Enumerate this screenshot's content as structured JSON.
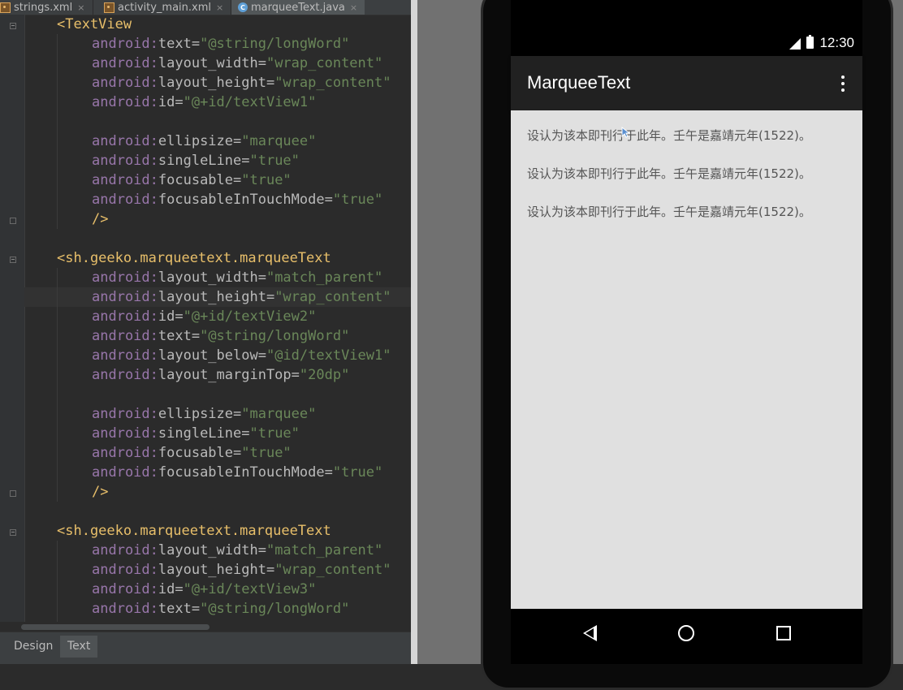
{
  "ide": {
    "tabs": [
      {
        "label": "strings.xml",
        "icon": "xml-file-icon"
      },
      {
        "label": "activity_main.xml",
        "icon": "xml-file-icon"
      },
      {
        "label": "marqueeText.java",
        "icon": "java-class-icon"
      }
    ],
    "tab_close": "×",
    "code_lines": [
      {
        "t": "<",
        "tag": "TextView"
      },
      {
        "a": "text",
        "v": "\"@string/longWord\""
      },
      {
        "a": "layout_width",
        "v": "\"wrap_content\""
      },
      {
        "a": "layout_height",
        "v": "\"wrap_content\""
      },
      {
        "a": "id",
        "v": "\"@+id/textView1\""
      },
      {},
      {
        "a": "ellipsize",
        "v": "\"marquee\""
      },
      {
        "a": "singleLine",
        "v": "\"true\""
      },
      {
        "a": "focusable",
        "v": "\"true\""
      },
      {
        "a": "focusableInTouchMode",
        "v": "\"true\""
      },
      {
        "close": "/>"
      },
      {},
      {
        "t": "<",
        "tag": "sh.geeko.marqueetext.marqueeText"
      },
      {
        "a": "layout_width",
        "v": "\"match_parent\""
      },
      {
        "a": "layout_height",
        "v": "\"wrap_content\""
      },
      {
        "a": "id",
        "v": "\"@+id/textView2\""
      },
      {
        "a": "text",
        "v": "\"@string/longWord\""
      },
      {
        "a": "layout_below",
        "v": "\"@id/textView1\""
      },
      {
        "a": "layout_marginTop",
        "v": "\"20dp\""
      },
      {},
      {
        "a": "ellipsize",
        "v": "\"marquee\""
      },
      {
        "a": "singleLine",
        "v": "\"true\""
      },
      {
        "a": "focusable",
        "v": "\"true\""
      },
      {
        "a": "focusableInTouchMode",
        "v": "\"true\""
      },
      {
        "close": "/>"
      },
      {},
      {
        "t": "<",
        "tag": "sh.geeko.marqueetext.marqueeText"
      },
      {
        "a": "layout_width",
        "v": "\"match_parent\""
      },
      {
        "a": "layout_height",
        "v": "\"wrap_content\""
      },
      {
        "a": "id",
        "v": "\"@+id/textView3\""
      },
      {
        "a": "text",
        "v": "\"@string/longWord\""
      }
    ],
    "ns_prefix": "android:",
    "bottom_tabs": {
      "design": "Design",
      "text": "Text"
    }
  },
  "device": {
    "status_time": "12:30",
    "app_title": "MarqueeText",
    "marquee_lines": [
      "设认为该本即刊行于此年。壬午是嘉靖元年(1522)。",
      "设认为该本即刊行于此年。壬午是嘉靖元年(1522)。",
      "设认为该本即刊行于此年。壬午是嘉靖元年(1522)。"
    ]
  },
  "colors": {
    "ide_bg": "#2b2b2b",
    "xml_tag": "#e8bf6a",
    "xml_ns": "#9876aa",
    "xml_value": "#6a8759",
    "appbar": "#212121",
    "content_bg": "#e0e0e0"
  }
}
